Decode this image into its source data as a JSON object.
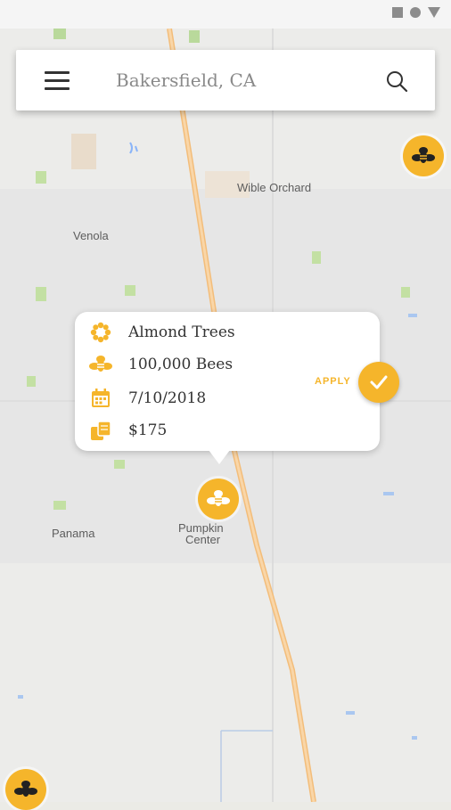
{
  "search": {
    "location": "Bakersfield, CA"
  },
  "map": {
    "places": [
      "Wible Orchard",
      "Venola",
      "Panama",
      "Pumpkin",
      "Center"
    ]
  },
  "popup": {
    "crop": "Almond Trees",
    "bees": "100,000 Bees",
    "date": "7/10/2018",
    "price": "$175",
    "apply_label": "APPLY"
  },
  "colors": {
    "accent": "#f5b52b",
    "road": "#f6c98a"
  }
}
